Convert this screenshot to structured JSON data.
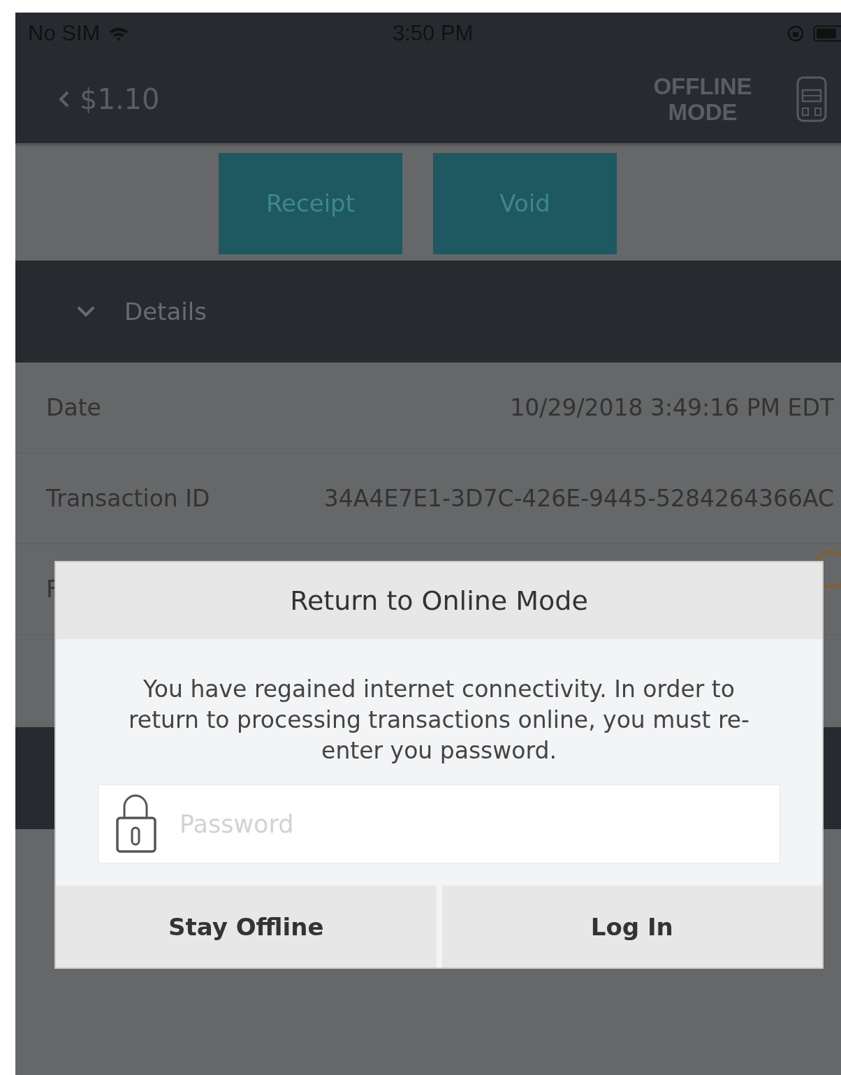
{
  "status_bar": {
    "carrier": "No SIM",
    "time": "3:50 PM"
  },
  "nav": {
    "back_label": "$1.10",
    "mode_label": "OFFLINE MODE"
  },
  "actions": [
    "Receipt",
    "Void"
  ],
  "details": {
    "title": "Details",
    "expanded": true,
    "rows": [
      {
        "label": "Date",
        "value": "10/29/2018 3:49:16 PM EDT"
      },
      {
        "label": "Transaction ID",
        "value": "34A4E7E1-3D7C-426E-9445-5284264366AC"
      },
      {
        "label": "F",
        "kind": "status"
      }
    ]
  },
  "dialog": {
    "title": "Return to Online Mode",
    "message": "You have regained internet connectivity. In order to return to processing transactions online, you must re-enter you password.",
    "password": {
      "placeholder": "Password"
    },
    "buttons": [
      "Stay Offline",
      "Log In"
    ]
  }
}
